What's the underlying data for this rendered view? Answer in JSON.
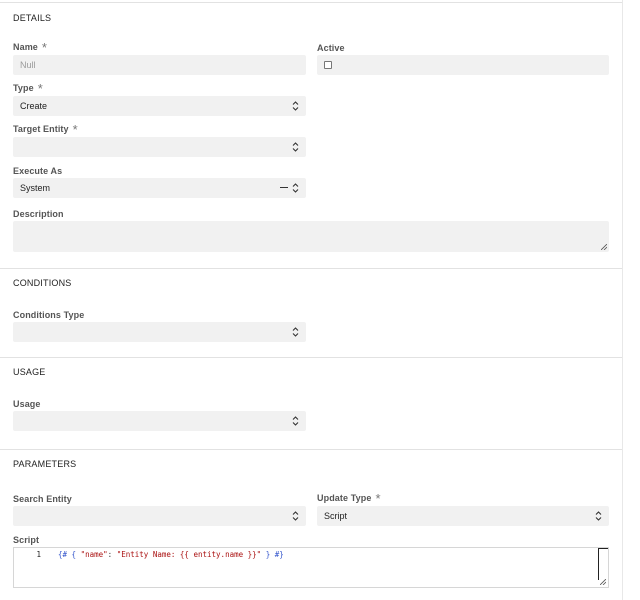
{
  "sections": {
    "details": "DETAILS",
    "conditions": "CONDITIONS",
    "usage": "USAGE",
    "parameters": "PARAMETERS"
  },
  "details": {
    "name_label": "Name",
    "name_placeholder": "Null",
    "active_label": "Active",
    "type_label": "Type",
    "type_value": "Create",
    "target_entity_label": "Target Entity",
    "target_entity_value": "",
    "execute_as_label": "Execute As",
    "execute_as_value": "System",
    "description_label": "Description",
    "required_mark": "*"
  },
  "conditions": {
    "type_label": "Conditions Type",
    "type_value": ""
  },
  "usage": {
    "usage_label": "Usage",
    "usage_value": ""
  },
  "parameters": {
    "search_entity_label": "Search Entity",
    "search_entity_value": "",
    "update_type_label": "Update Type",
    "update_type_value": "Script",
    "script_label": "Script",
    "line_number": "1",
    "code_open": "{# {",
    "code_key": "\"name\"",
    "code_colon": ": ",
    "code_value": "\"Entity Name: {{ entity.name }}\"",
    "code_close": "} #}"
  }
}
